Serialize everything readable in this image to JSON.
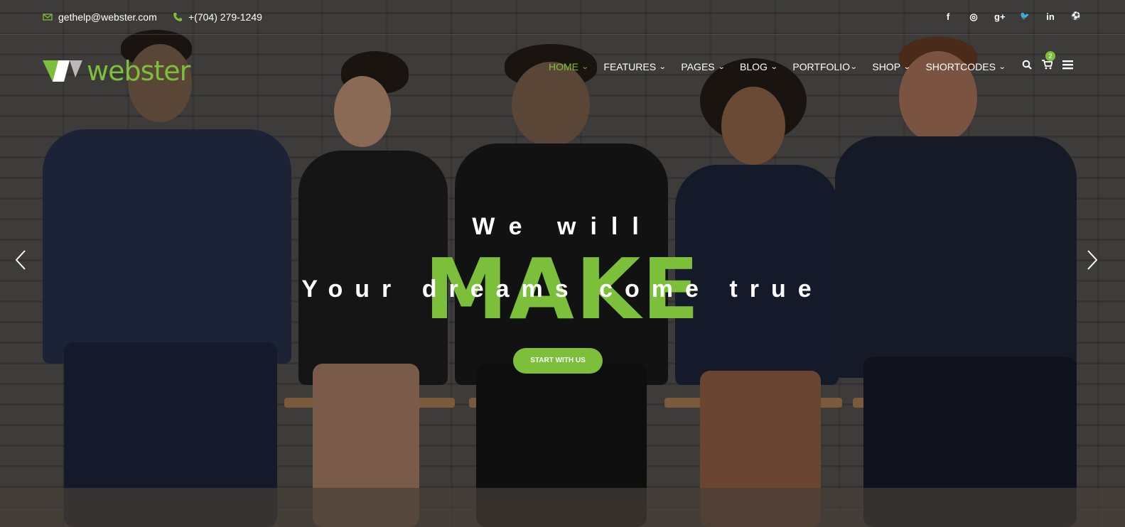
{
  "topbar": {
    "email": "gethelp@webster.com",
    "phone": "+(704) 279-1249",
    "social": [
      {
        "icon": "facebook-icon",
        "glyph": "f"
      },
      {
        "icon": "instagram-icon",
        "glyph": "◎"
      },
      {
        "icon": "google-plus-icon",
        "glyph": "g+"
      },
      {
        "icon": "twitter-icon",
        "glyph": "🐦"
      },
      {
        "icon": "linkedin-icon",
        "glyph": "in"
      },
      {
        "icon": "dribbble-icon",
        "glyph": "⚽"
      }
    ]
  },
  "logo": {
    "text": "webster"
  },
  "nav": {
    "items": [
      {
        "label": "HOME",
        "active": true
      },
      {
        "label": "FEATURES"
      },
      {
        "label": "PAGES"
      },
      {
        "label": "BLOG"
      },
      {
        "label": "PORTFOLIO"
      },
      {
        "label": "SHOP"
      },
      {
        "label": "SHORTCODES"
      }
    ],
    "cart_count": "2"
  },
  "hero": {
    "line1": "We will",
    "line2": "MAKE",
    "line3": "Your dreams come true",
    "cta": "START WITH US"
  },
  "colors": {
    "accent": "#7cbf3b",
    "text": "#ffffff"
  }
}
